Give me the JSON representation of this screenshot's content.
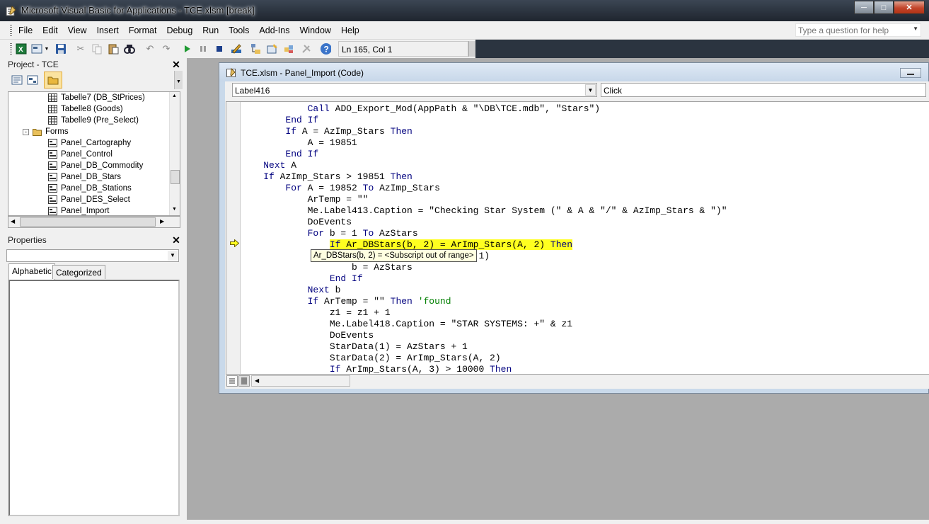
{
  "window": {
    "title": "Microsoft Visual Basic for Applications - TCE.xlsm [break]"
  },
  "menu": [
    "File",
    "Edit",
    "View",
    "Insert",
    "Format",
    "Debug",
    "Run",
    "Tools",
    "Add-Ins",
    "Window",
    "Help"
  ],
  "help_box": {
    "placeholder": "Type a question for help"
  },
  "toolbar": {
    "status": "Ln 165, Col 1"
  },
  "project": {
    "title": "Project - TCE",
    "tree": [
      {
        "label": "Tabelle7 (DB_StPrices)",
        "type": "sheet",
        "indent": 2
      },
      {
        "label": "Tabelle8 (Goods)",
        "type": "sheet",
        "indent": 2
      },
      {
        "label": "Tabelle9 (Pre_Select)",
        "type": "sheet",
        "indent": 2
      },
      {
        "label": "Forms",
        "type": "folder",
        "indent": 1
      },
      {
        "label": "Panel_Cartography",
        "type": "form",
        "indent": 2
      },
      {
        "label": "Panel_Control",
        "type": "form",
        "indent": 2
      },
      {
        "label": "Panel_DB_Commodity",
        "type": "form",
        "indent": 2
      },
      {
        "label": "Panel_DB_Stars",
        "type": "form",
        "indent": 2
      },
      {
        "label": "Panel_DB_Stations",
        "type": "form",
        "indent": 2
      },
      {
        "label": "Panel_DES_Select",
        "type": "form",
        "indent": 2
      },
      {
        "label": "Panel_Import",
        "type": "form",
        "indent": 2
      }
    ]
  },
  "properties": {
    "title": "Properties",
    "tabs": [
      "Alphabetic",
      "Categorized"
    ]
  },
  "code_window": {
    "title": "TCE.xlsm - Panel_Import (Code)",
    "object_combo": "Label416",
    "proc_combo": "Click",
    "tooltip": "Ar_DBStars(b, 2) = <Subscript out of range>",
    "lines": [
      [
        [
          "            ",
          ""
        ],
        [
          "Call",
          "kw"
        ],
        [
          " ADO_Export_Mod(AppPath & \"\\DB\\TCE.mdb\", \"Stars\")",
          ""
        ]
      ],
      [
        [
          "        ",
          ""
        ],
        [
          "End If",
          "kw"
        ]
      ],
      [
        [
          "        ",
          ""
        ],
        [
          "If",
          "kw"
        ],
        [
          " A = AzImp_Stars ",
          ""
        ],
        [
          "Then",
          "kw"
        ]
      ],
      [
        [
          "            A = 19851",
          ""
        ]
      ],
      [
        [
          "        ",
          ""
        ],
        [
          "End If",
          "kw"
        ]
      ],
      [
        [
          "    ",
          ""
        ],
        [
          "Next",
          "kw"
        ],
        [
          " A",
          ""
        ]
      ],
      [
        [
          "    ",
          ""
        ],
        [
          "If",
          "kw"
        ],
        [
          " AzImp_Stars > 19851 ",
          ""
        ],
        [
          "Then",
          "kw"
        ]
      ],
      [
        [
          "        ",
          ""
        ],
        [
          "For",
          "kw"
        ],
        [
          " A = 19852 ",
          ""
        ],
        [
          "To",
          "kw"
        ],
        [
          " AzImp_Stars",
          ""
        ]
      ],
      [
        [
          "            ArTemp = \"\"",
          ""
        ]
      ],
      [
        [
          "            Me.Label413.Caption = \"Checking Star System (\" & A & \"/\" & AzImp_Stars & \")\"",
          ""
        ]
      ],
      [
        [
          "            DoEvents",
          ""
        ]
      ],
      [
        [
          "            ",
          ""
        ],
        [
          "For",
          "kw"
        ],
        [
          " b = 1 ",
          ""
        ],
        [
          "To",
          "kw"
        ],
        [
          " AzStars",
          ""
        ]
      ],
      [
        [
          "                ",
          ""
        ],
        [
          "If",
          "kw hl"
        ],
        [
          " Ar_DBStars(b, 2) = ArImp_Stars(A, 2) ",
          "hl"
        ],
        [
          "Then",
          "kw hl"
        ]
      ],
      [
        [
          "                    ArTemp = Ar_DBStars(b, 1)",
          ""
        ]
      ],
      [
        [
          "                    b = AzStars",
          ""
        ]
      ],
      [
        [
          "                ",
          ""
        ],
        [
          "End If",
          "kw"
        ]
      ],
      [
        [
          "            ",
          ""
        ],
        [
          "Next",
          "kw"
        ],
        [
          " b",
          ""
        ]
      ],
      [
        [
          "            ",
          ""
        ],
        [
          "If",
          "kw"
        ],
        [
          " ArTemp = \"\" ",
          ""
        ],
        [
          "Then",
          "kw"
        ],
        [
          " ",
          ""
        ],
        [
          "'found",
          "cm"
        ]
      ],
      [
        [
          "                z1 = z1 + 1",
          ""
        ]
      ],
      [
        [
          "                Me.Label418.Caption = \"STAR SYSTEMS: +\" & z1",
          ""
        ]
      ],
      [
        [
          "                DoEvents",
          ""
        ]
      ],
      [
        [
          "                StarData(1) = AzStars + 1",
          ""
        ]
      ],
      [
        [
          "                StarData(2) = ArImp_Stars(A, 2)",
          ""
        ]
      ],
      [
        [
          "                ",
          ""
        ],
        [
          "If",
          "kw"
        ],
        [
          " ArImp_Stars(A, 3) > 10000 ",
          ""
        ],
        [
          "Then",
          "kw"
        ]
      ]
    ],
    "current_line_index": 12
  },
  "colors": {
    "keyword": "#00007f",
    "comment": "#007f00",
    "highlight": "#ffff20"
  }
}
